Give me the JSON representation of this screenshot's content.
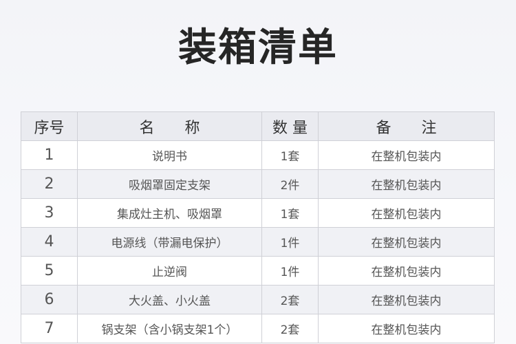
{
  "title": "装箱清单",
  "table": {
    "headers": {
      "no": "序号",
      "name": "名　　称",
      "qty": "数 量",
      "note": "备　　注"
    },
    "rows": [
      {
        "no": "1",
        "name": "说明书",
        "qty": "1套",
        "note": "在整机包装内"
      },
      {
        "no": "2",
        "name": "吸烟罩固定支架",
        "qty": "2件",
        "note": "在整机包装内"
      },
      {
        "no": "3",
        "name": "集成灶主机、吸烟罩",
        "qty": "1套",
        "note": "在整机包装内"
      },
      {
        "no": "4",
        "name": "电源线（带漏电保护）",
        "qty": "1件",
        "note": "在整机包装内"
      },
      {
        "no": "5",
        "name": "止逆阀",
        "qty": "1件",
        "note": "在整机包装内"
      },
      {
        "no": "6",
        "name": "大火盖、小火盖",
        "qty": "2套",
        "note": "在整机包装内"
      },
      {
        "no": "7",
        "name": "锅支架（含小锅支架1个）",
        "qty": "2套",
        "note": "在整机包装内"
      }
    ]
  }
}
